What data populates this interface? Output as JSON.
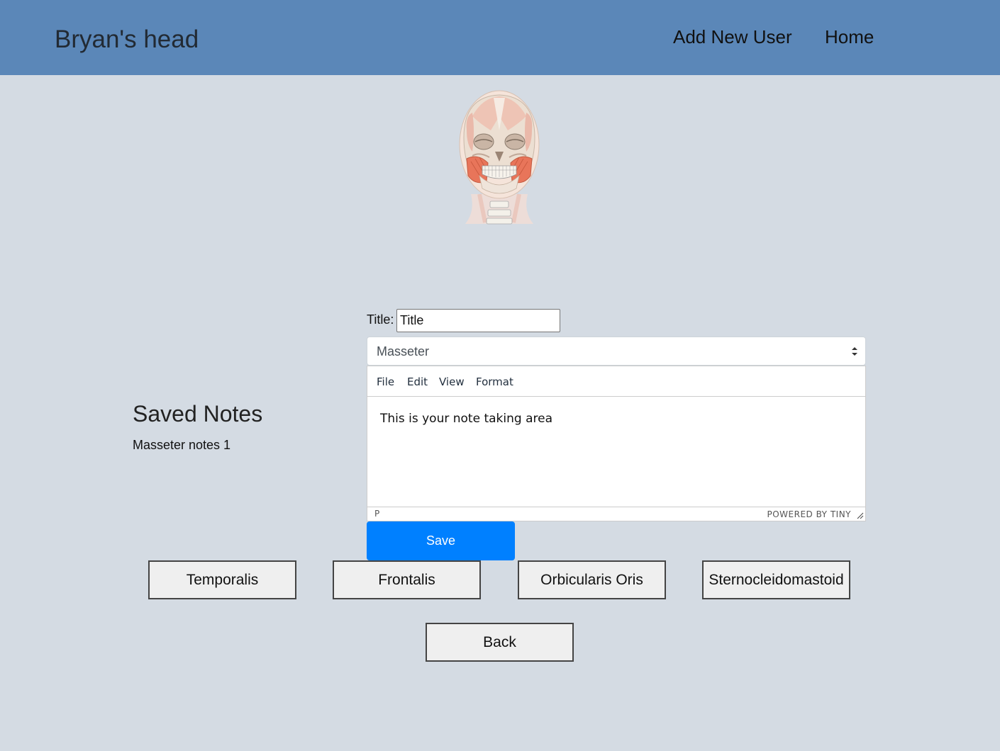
{
  "navbar": {
    "brand": "Bryan's head",
    "links": [
      "Add New User",
      "Home"
    ],
    "background": "#5b87b8"
  },
  "head_image": {
    "icon": "skull-muscle-diagram"
  },
  "saved_notes": {
    "title": "Saved Notes",
    "items": [
      "Masseter notes 1"
    ]
  },
  "note_form": {
    "title_label": "Title:",
    "title_value": "Title",
    "muscle_select": "Masseter",
    "menubar": [
      "File",
      "Edit",
      "View",
      "Format"
    ],
    "body_text": "This is your note taking area",
    "status_path": "P",
    "status_brand": "POWERED BY TINY",
    "save_label": "Save",
    "save_color": "#0080ff"
  },
  "muscle_buttons": [
    "Temporalis",
    "Frontalis",
    "Orbicularis Oris",
    "Sternocleidomastoid"
  ],
  "back_label": "Back",
  "page_background": "#d4dbe3"
}
